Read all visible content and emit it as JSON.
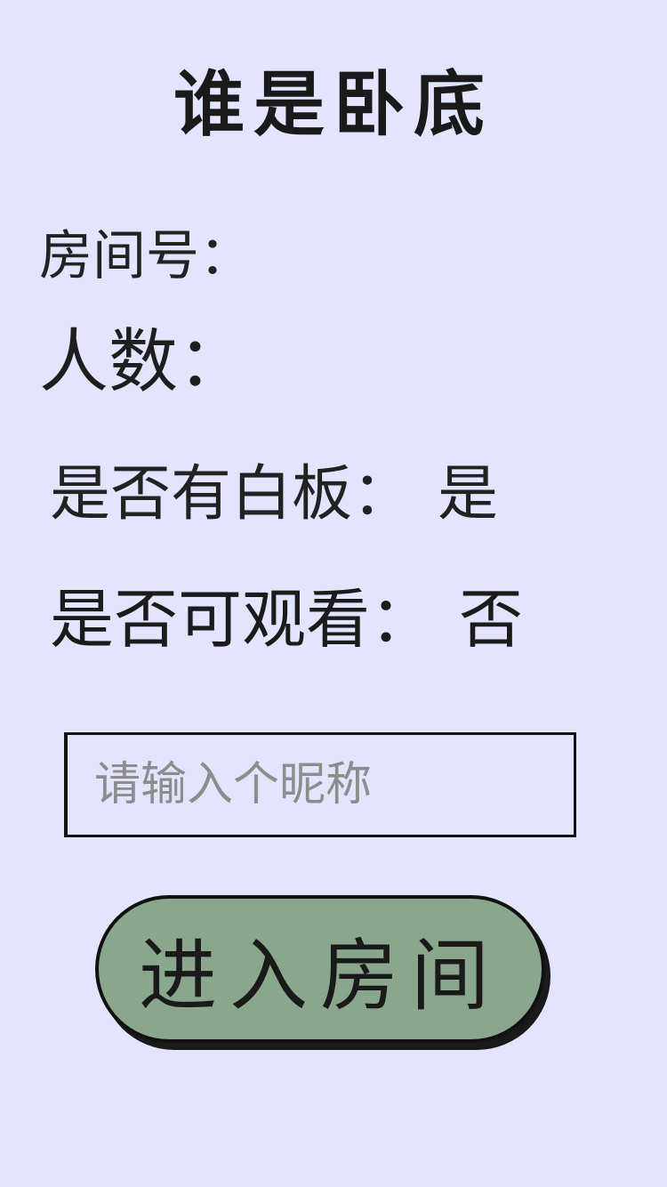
{
  "title": "谁是卧底",
  "room": {
    "room_number_label": "房间号：",
    "players_label": "人数："
  },
  "settings": {
    "whiteboard_label": "是否有白板：",
    "whiteboard_value": "是",
    "spectate_label": "是否可观看：",
    "spectate_value": "否"
  },
  "nickname": {
    "placeholder": "请输入个昵称",
    "value": ""
  },
  "actions": {
    "enter_room": "进入房间"
  }
}
